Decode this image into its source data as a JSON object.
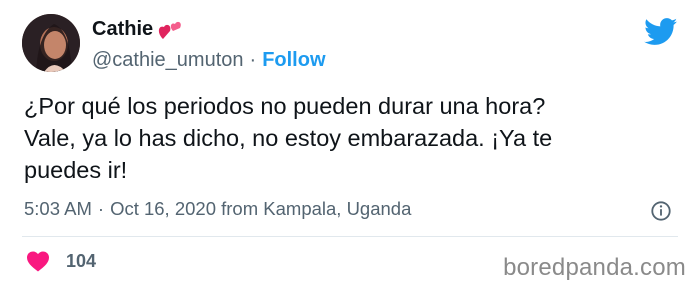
{
  "author": {
    "display_name": "Cathie",
    "handle": "@cathie_umuton",
    "separator": "·",
    "follow_label": "Follow"
  },
  "tweet": {
    "text": "¿Por qué los periodos no pueden durar una hora?\nVale, ya lo has dicho, no estoy embarazada. ¡Ya te\npuedes ir!",
    "time": "5:03 AM",
    "separator": "·",
    "date_location": "Oct 16, 2020 from Kampala, Uganda",
    "likes": "104"
  },
  "watermark": "boredpanda.com",
  "colors": {
    "accent": "#1d9bf0",
    "like": "#f91880",
    "muted": "#536471"
  },
  "icons": [
    "avatar-photo",
    "hearts-emoji",
    "twitter-bird-icon",
    "info-icon",
    "heart-icon"
  ]
}
